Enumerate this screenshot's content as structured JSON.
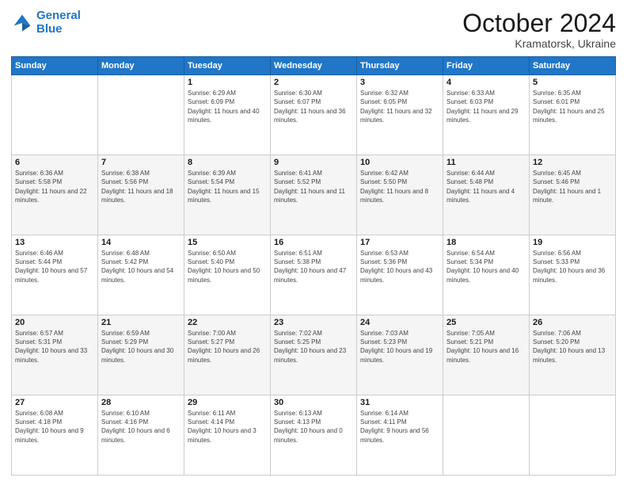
{
  "logo": {
    "line1": "General",
    "line2": "Blue"
  },
  "header": {
    "month": "October 2024",
    "location": "Kramatorsk, Ukraine"
  },
  "days_of_week": [
    "Sunday",
    "Monday",
    "Tuesday",
    "Wednesday",
    "Thursday",
    "Friday",
    "Saturday"
  ],
  "weeks": [
    [
      {
        "day": "",
        "sunrise": "",
        "sunset": "",
        "daylight": ""
      },
      {
        "day": "",
        "sunrise": "",
        "sunset": "",
        "daylight": ""
      },
      {
        "day": "1",
        "sunrise": "Sunrise: 6:29 AM",
        "sunset": "Sunset: 6:09 PM",
        "daylight": "Daylight: 11 hours and 40 minutes."
      },
      {
        "day": "2",
        "sunrise": "Sunrise: 6:30 AM",
        "sunset": "Sunset: 6:07 PM",
        "daylight": "Daylight: 11 hours and 36 minutes."
      },
      {
        "day": "3",
        "sunrise": "Sunrise: 6:32 AM",
        "sunset": "Sunset: 6:05 PM",
        "daylight": "Daylight: 11 hours and 32 minutes."
      },
      {
        "day": "4",
        "sunrise": "Sunrise: 6:33 AM",
        "sunset": "Sunset: 6:03 PM",
        "daylight": "Daylight: 11 hours and 29 minutes."
      },
      {
        "day": "5",
        "sunrise": "Sunrise: 6:35 AM",
        "sunset": "Sunset: 6:01 PM",
        "daylight": "Daylight: 11 hours and 25 minutes."
      }
    ],
    [
      {
        "day": "6",
        "sunrise": "Sunrise: 6:36 AM",
        "sunset": "Sunset: 5:58 PM",
        "daylight": "Daylight: 11 hours and 22 minutes."
      },
      {
        "day": "7",
        "sunrise": "Sunrise: 6:38 AM",
        "sunset": "Sunset: 5:56 PM",
        "daylight": "Daylight: 11 hours and 18 minutes."
      },
      {
        "day": "8",
        "sunrise": "Sunrise: 6:39 AM",
        "sunset": "Sunset: 5:54 PM",
        "daylight": "Daylight: 11 hours and 15 minutes."
      },
      {
        "day": "9",
        "sunrise": "Sunrise: 6:41 AM",
        "sunset": "Sunset: 5:52 PM",
        "daylight": "Daylight: 11 hours and 11 minutes."
      },
      {
        "day": "10",
        "sunrise": "Sunrise: 6:42 AM",
        "sunset": "Sunset: 5:50 PM",
        "daylight": "Daylight: 11 hours and 8 minutes."
      },
      {
        "day": "11",
        "sunrise": "Sunrise: 6:44 AM",
        "sunset": "Sunset: 5:48 PM",
        "daylight": "Daylight: 11 hours and 4 minutes."
      },
      {
        "day": "12",
        "sunrise": "Sunrise: 6:45 AM",
        "sunset": "Sunset: 5:46 PM",
        "daylight": "Daylight: 11 hours and 1 minute."
      }
    ],
    [
      {
        "day": "13",
        "sunrise": "Sunrise: 6:46 AM",
        "sunset": "Sunset: 5:44 PM",
        "daylight": "Daylight: 10 hours and 57 minutes."
      },
      {
        "day": "14",
        "sunrise": "Sunrise: 6:48 AM",
        "sunset": "Sunset: 5:42 PM",
        "daylight": "Daylight: 10 hours and 54 minutes."
      },
      {
        "day": "15",
        "sunrise": "Sunrise: 6:50 AM",
        "sunset": "Sunset: 5:40 PM",
        "daylight": "Daylight: 10 hours and 50 minutes."
      },
      {
        "day": "16",
        "sunrise": "Sunrise: 6:51 AM",
        "sunset": "Sunset: 5:38 PM",
        "daylight": "Daylight: 10 hours and 47 minutes."
      },
      {
        "day": "17",
        "sunrise": "Sunrise: 6:53 AM",
        "sunset": "Sunset: 5:36 PM",
        "daylight": "Daylight: 10 hours and 43 minutes."
      },
      {
        "day": "18",
        "sunrise": "Sunrise: 6:54 AM",
        "sunset": "Sunset: 5:34 PM",
        "daylight": "Daylight: 10 hours and 40 minutes."
      },
      {
        "day": "19",
        "sunrise": "Sunrise: 6:56 AM",
        "sunset": "Sunset: 5:33 PM",
        "daylight": "Daylight: 10 hours and 36 minutes."
      }
    ],
    [
      {
        "day": "20",
        "sunrise": "Sunrise: 6:57 AM",
        "sunset": "Sunset: 5:31 PM",
        "daylight": "Daylight: 10 hours and 33 minutes."
      },
      {
        "day": "21",
        "sunrise": "Sunrise: 6:59 AM",
        "sunset": "Sunset: 5:29 PM",
        "daylight": "Daylight: 10 hours and 30 minutes."
      },
      {
        "day": "22",
        "sunrise": "Sunrise: 7:00 AM",
        "sunset": "Sunset: 5:27 PM",
        "daylight": "Daylight: 10 hours and 26 minutes."
      },
      {
        "day": "23",
        "sunrise": "Sunrise: 7:02 AM",
        "sunset": "Sunset: 5:25 PM",
        "daylight": "Daylight: 10 hours and 23 minutes."
      },
      {
        "day": "24",
        "sunrise": "Sunrise: 7:03 AM",
        "sunset": "Sunset: 5:23 PM",
        "daylight": "Daylight: 10 hours and 19 minutes."
      },
      {
        "day": "25",
        "sunrise": "Sunrise: 7:05 AM",
        "sunset": "Sunset: 5:21 PM",
        "daylight": "Daylight: 10 hours and 16 minutes."
      },
      {
        "day": "26",
        "sunrise": "Sunrise: 7:06 AM",
        "sunset": "Sunset: 5:20 PM",
        "daylight": "Daylight: 10 hours and 13 minutes."
      }
    ],
    [
      {
        "day": "27",
        "sunrise": "Sunrise: 6:08 AM",
        "sunset": "Sunset: 4:18 PM",
        "daylight": "Daylight: 10 hours and 9 minutes."
      },
      {
        "day": "28",
        "sunrise": "Sunrise: 6:10 AM",
        "sunset": "Sunset: 4:16 PM",
        "daylight": "Daylight: 10 hours and 6 minutes."
      },
      {
        "day": "29",
        "sunrise": "Sunrise: 6:11 AM",
        "sunset": "Sunset: 4:14 PM",
        "daylight": "Daylight: 10 hours and 3 minutes."
      },
      {
        "day": "30",
        "sunrise": "Sunrise: 6:13 AM",
        "sunset": "Sunset: 4:13 PM",
        "daylight": "Daylight: 10 hours and 0 minutes."
      },
      {
        "day": "31",
        "sunrise": "Sunrise: 6:14 AM",
        "sunset": "Sunset: 4:11 PM",
        "daylight": "Daylight: 9 hours and 56 minutes."
      },
      {
        "day": "",
        "sunrise": "",
        "sunset": "",
        "daylight": ""
      },
      {
        "day": "",
        "sunrise": "",
        "sunset": "",
        "daylight": ""
      }
    ]
  ]
}
